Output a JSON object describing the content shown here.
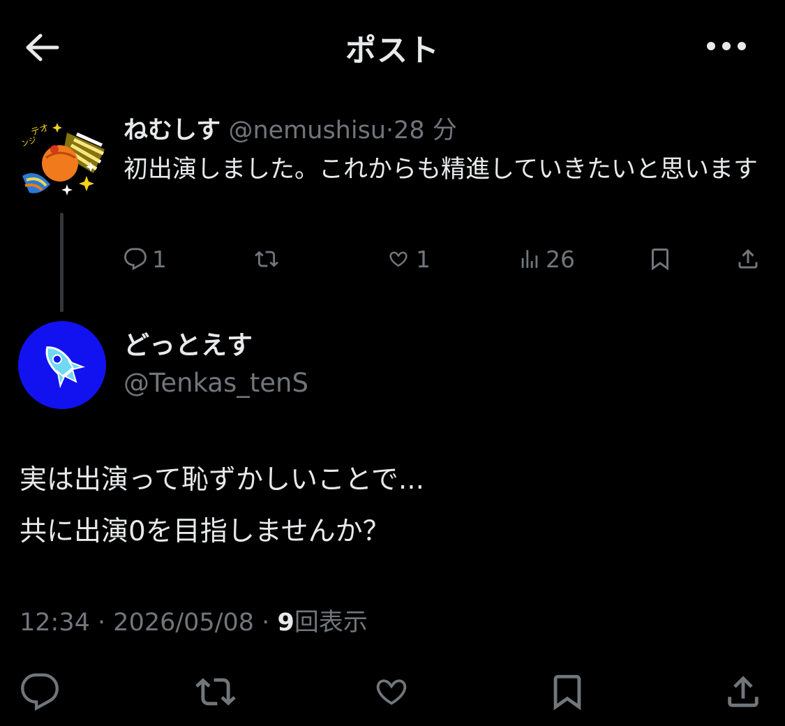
{
  "header": {
    "title": "ポスト"
  },
  "parent_post": {
    "display_name": "ねむしす",
    "handle": "@nemushisu",
    "separator": "·",
    "time": "28 分",
    "text": "初出演しました。これからも精進していきたいと思います",
    "actions": {
      "replies": "1",
      "likes": "1",
      "views": "26"
    }
  },
  "post": {
    "display_name": "どっとえす",
    "handle": "@Tenkas_tenS",
    "lines": [
      "実は出演って恥ずかしいことで...",
      "共に出演0を目指しませんか？"
    ],
    "meta": {
      "time": "12:34",
      "sep1": "·",
      "date": "2026/05/08",
      "sep2": "·",
      "views_count": "9",
      "views_label": "回表示"
    }
  },
  "colors": {
    "background": "#000000",
    "text_primary": "#e7e9ea",
    "text_secondary": "#71767b",
    "avatar2_bg": "#1212f0"
  },
  "icons": [
    "back-arrow-icon",
    "more-icon",
    "reply-icon",
    "retweet-icon",
    "like-icon",
    "views-icon",
    "bookmark-icon",
    "share-icon"
  ]
}
